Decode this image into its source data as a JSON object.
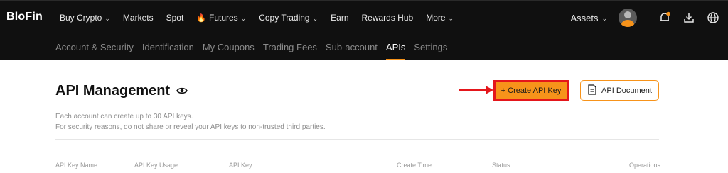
{
  "brand": {
    "logo_text": "BloFin"
  },
  "topnav": {
    "items": [
      {
        "label": "Buy Crypto",
        "dropdown": true
      },
      {
        "label": "Markets",
        "dropdown": false
      },
      {
        "label": "Spot",
        "dropdown": false
      },
      {
        "label": "Futures",
        "dropdown": true,
        "icon": "flame-icon"
      },
      {
        "label": "Copy Trading",
        "dropdown": true
      },
      {
        "label": "Earn",
        "dropdown": false
      },
      {
        "label": "Rewards Hub",
        "dropdown": false
      },
      {
        "label": "More",
        "dropdown": true
      }
    ],
    "assets_label": "Assets",
    "icons": [
      "avatar",
      "notification-bell-icon",
      "download-icon",
      "globe-icon"
    ]
  },
  "subnav": {
    "items": [
      "Account & Security",
      "Identification",
      "My Coupons",
      "Trading Fees",
      "Sub-account",
      "APIs",
      "Settings"
    ],
    "active": "APIs"
  },
  "main": {
    "title": "API Management",
    "description_line1": "Each account can create up to 30 API keys.",
    "description_line2": "For security reasons, do not share or reveal your API keys to non-trusted third parties.",
    "create_button": "+ Create API Key",
    "doc_button": "API Document",
    "table_headers": [
      "API Key Name",
      "API Key Usage",
      "API Key",
      "Create Time",
      "Status",
      "Operations"
    ]
  },
  "colors": {
    "accent": "#f7931a",
    "highlight_red": "#e4161b",
    "topbar_bg": "#101010"
  }
}
